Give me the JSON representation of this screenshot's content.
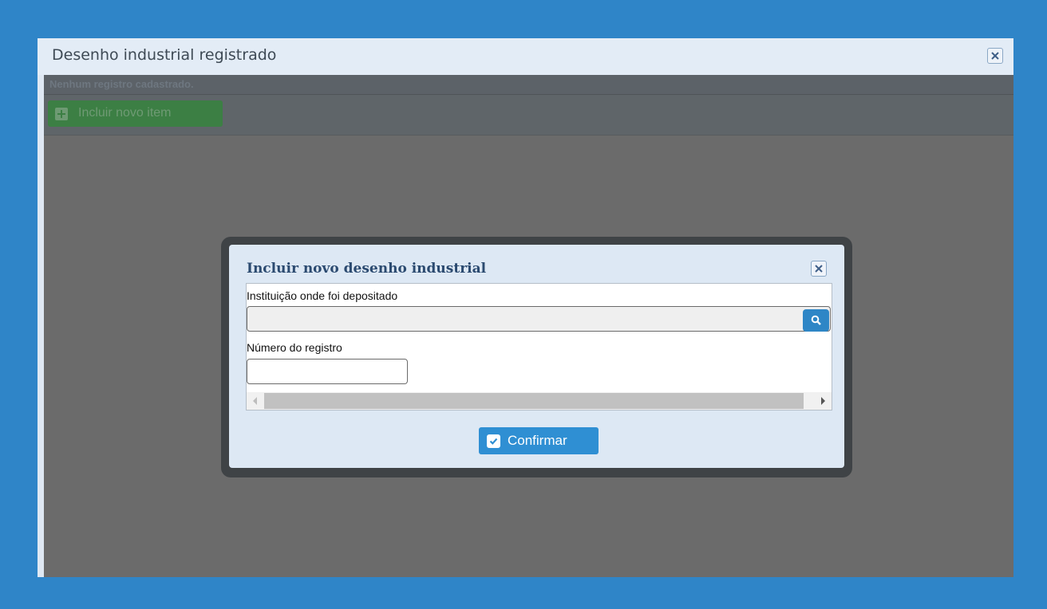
{
  "outer_window": {
    "title": "Desenho industrial registrado",
    "close_icon": "close-icon"
  },
  "content": {
    "empty_message": "Nenhum registro cadastrado.",
    "add_button_label": "Incluir novo item",
    "add_icon": "plus-square-icon"
  },
  "modal": {
    "title": "Incluir novo desenho industrial",
    "close_icon": "close-icon",
    "fields": {
      "institution_label": "Instituição onde foi depositado",
      "institution_value": "",
      "search_icon": "search-icon",
      "registration_label": "Número do registro",
      "registration_value": ""
    },
    "confirm_label": "Confirmar",
    "confirm_icon": "check-icon"
  },
  "colors": {
    "background": "#2f85c8",
    "overlay": "#6b6b6b",
    "accent": "#2f8fd3",
    "add_button": "#3c7f44"
  }
}
